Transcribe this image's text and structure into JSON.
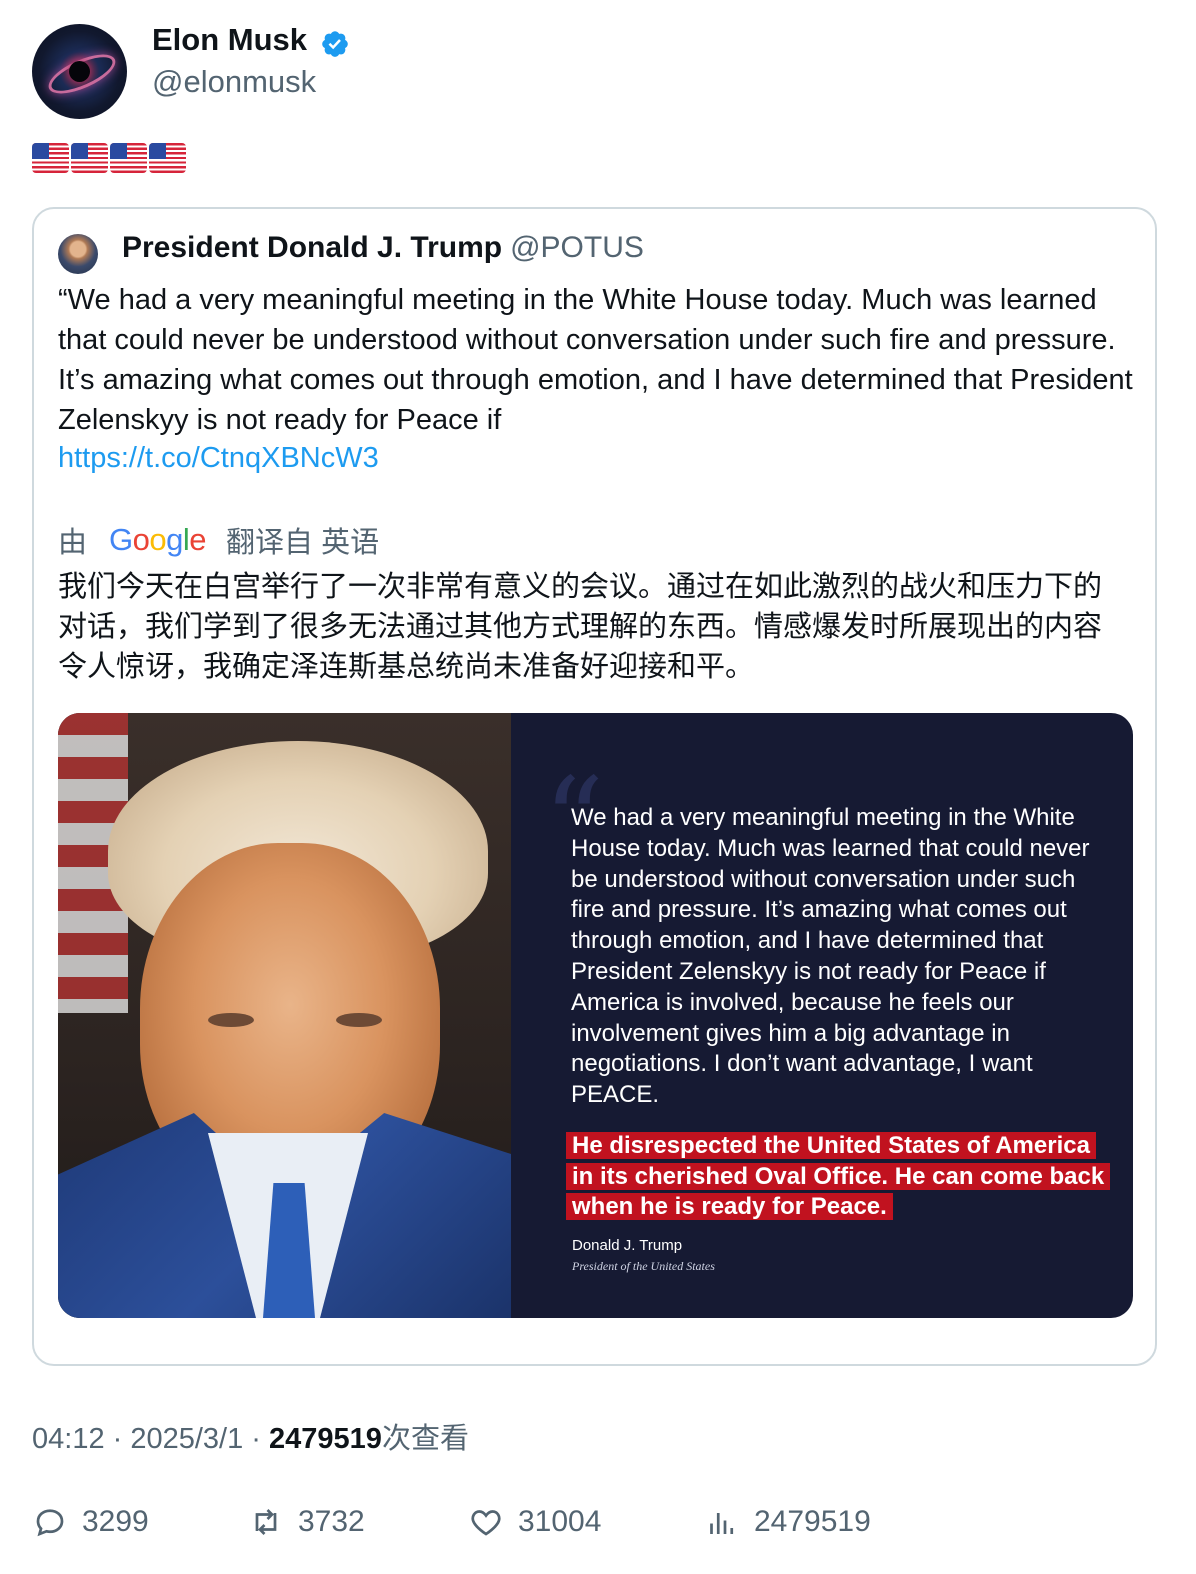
{
  "author": {
    "name": "Elon Musk",
    "handle": "@elonmusk",
    "verified": true,
    "avatar_icon": "galaxy-avatar"
  },
  "post": {
    "emoji": "🇺🇸🇺🇸🇺🇸🇺🇸",
    "flag_count": 4
  },
  "quoted": {
    "name": "President Donald J. Trump",
    "handle": "@POTUS",
    "text": "“We had a very meaningful meeting in the White House today. Much was learned that could never be understood without conversation under such fire and pressure. It’s amazing what comes out through emotion, and I have determined that President Zelenskyy is not ready for Peace if",
    "link": "https://t.co/CtnqXBNcW3",
    "translation": {
      "by": "由",
      "provider": "Google",
      "label": "翻译自 英语",
      "text": "我们今天在白宫举行了一次非常有意义的会议。通过在如此激烈的战火和压力下的对话，我们学到了很多无法通过其他方式理解的东西。情感爆发时所展现出的内容令人惊讶，我确定泽连斯基总统尚未准备好迎接和平。"
    },
    "image": {
      "quote_mark": "“",
      "text": "We had a very meaningful meeting in the White House today. Much was learned that could never be understood without conversation under such fire and pressure. It’s amazing what comes out through emotion, and I have determined that President Zelenskyy is not ready for Peace if America is involved, because he feels our involvement gives him a big advantage in negotiations. I don’t want advantage, I want PEACE.",
      "highlight": "He disrespected the United States of America in its cherished Oval Office. He can come back when he is ready for Peace.",
      "signature_name": "Donald J. Trump",
      "signature_title": "President of the United States",
      "highlight_color": "#c1121f",
      "panel_color": "#161a33"
    }
  },
  "meta": {
    "time": "04:12",
    "sep1": " · ",
    "date": "2025/3/1",
    "sep2": " · ",
    "views": "2479519",
    "views_label": "次查看"
  },
  "stats": {
    "replies": "3299",
    "reposts": "3732",
    "likes": "31004",
    "views": "2479519"
  },
  "colors": {
    "link": "#1d9bf0",
    "secondary_text": "#536471",
    "verified": "#1d9bf0"
  }
}
